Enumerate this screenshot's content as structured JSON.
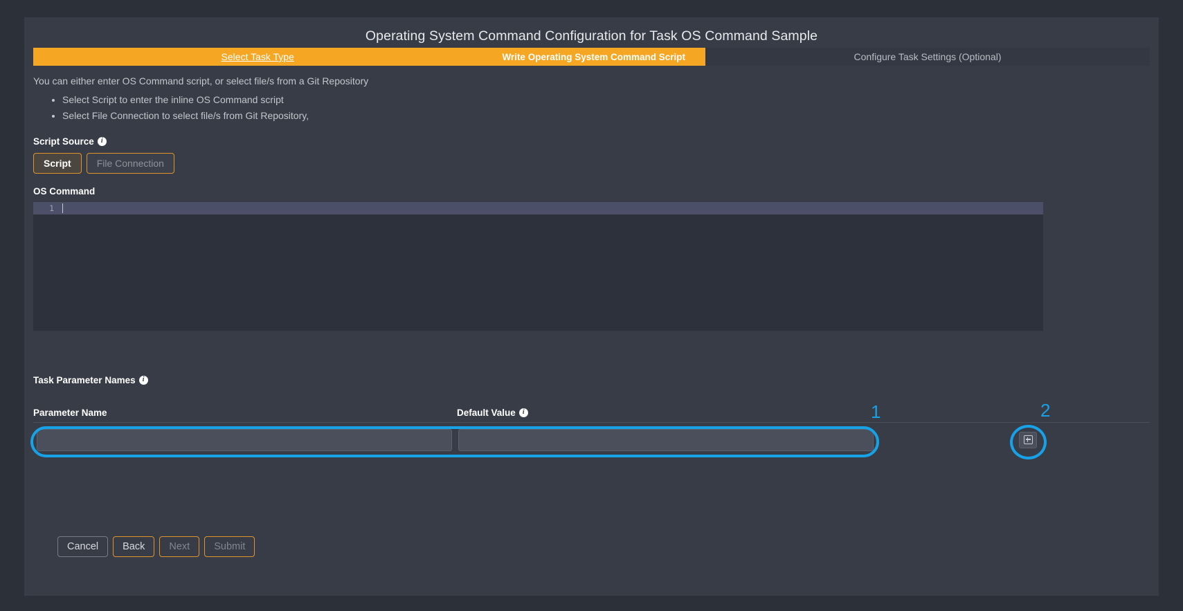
{
  "modal": {
    "title": "Operating System Command Configuration for Task OS Command Sample"
  },
  "tabs": [
    {
      "label": "Select Task Type",
      "state": "completed"
    },
    {
      "label": "Write Operating System Command Script",
      "state": "active"
    },
    {
      "label": "Configure Task Settings (Optional)",
      "state": "upcoming"
    }
  ],
  "intro": {
    "text": "You can either enter OS Command script, or select file/s from a Git Repository",
    "bullets": [
      "Select Script to enter the inline OS Command script",
      "Select File Connection to select file/s from Git Repository,"
    ]
  },
  "script_source": {
    "label": "Script Source",
    "info_icon": "info-icon",
    "options": [
      {
        "label": "Script",
        "selected": true
      },
      {
        "label": "File Connection",
        "selected": false
      }
    ]
  },
  "os_command": {
    "label": "OS Command",
    "line_number": "1",
    "value": ""
  },
  "task_parameters": {
    "label": "Task Parameter Names",
    "info_icon": "info-icon",
    "columns": [
      {
        "label": "Parameter Name",
        "has_info": false
      },
      {
        "label": "Default Value",
        "has_info": true
      }
    ],
    "rows": [
      {
        "parameter_name": "",
        "parameter_name_placeholder": "",
        "default_value": "",
        "default_value_placeholder": ""
      }
    ],
    "add_button_icon": "plus-square-icon"
  },
  "footer": {
    "buttons": [
      {
        "label": "Cancel",
        "disabled": false,
        "style": "neutral"
      },
      {
        "label": "Back",
        "disabled": false,
        "style": "primary"
      },
      {
        "label": "Next",
        "disabled": true,
        "style": "primary"
      },
      {
        "label": "Submit",
        "disabled": true,
        "style": "primary"
      }
    ]
  },
  "annotations": [
    {
      "number": "1",
      "target": "parameter-row-inputs"
    },
    {
      "number": "2",
      "target": "add-parameter-button"
    }
  ],
  "colors": {
    "accent": "#f5a623",
    "annotation": "#17a2e8",
    "panel": "#383c46",
    "page": "#2c3039",
    "editor": "#2d313c"
  }
}
